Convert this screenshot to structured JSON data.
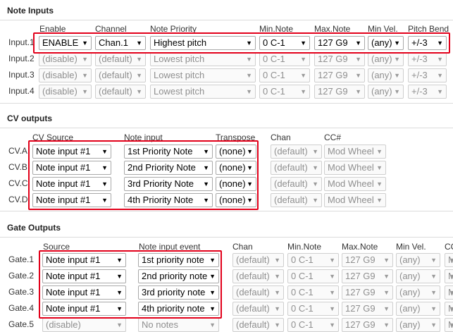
{
  "note_inputs": {
    "title": "Note Inputs",
    "headers": [
      "Enable",
      "Channel",
      "Note Priority",
      "Min.Note",
      "Max.Note",
      "Min Vel.",
      "Pitch Bend"
    ],
    "rows": [
      {
        "label": "Input.1",
        "enabled": true,
        "values": [
          "ENABLE",
          "Chan.1",
          "Highest pitch",
          "0 C-1",
          "127 G9",
          "(any)",
          "+/-3"
        ]
      },
      {
        "label": "Input.2",
        "enabled": false,
        "values": [
          "(disable)",
          "(default)",
          "Lowest pitch",
          "0 C-1",
          "127 G9",
          "(any)",
          "+/-3"
        ]
      },
      {
        "label": "Input.3",
        "enabled": false,
        "values": [
          "(disable)",
          "(default)",
          "Lowest pitch",
          "0 C-1",
          "127 G9",
          "(any)",
          "+/-3"
        ]
      },
      {
        "label": "Input.4",
        "enabled": false,
        "values": [
          "(disable)",
          "(default)",
          "Lowest pitch",
          "0 C-1",
          "127 G9",
          "(any)",
          "+/-3"
        ]
      }
    ]
  },
  "cv_outputs": {
    "title": "CV outputs",
    "headers": [
      "CV Source",
      "Note input",
      "Transpose",
      "Chan",
      "CC#"
    ],
    "rows": [
      {
        "label": "CV.A",
        "values": [
          "Note input #1",
          "1st Priority Note",
          "(none)",
          "(default)",
          "Mod Wheel"
        ]
      },
      {
        "label": "CV.B",
        "values": [
          "Note input #1",
          "2nd Priority Note",
          "(none)",
          "(default)",
          "Mod Wheel"
        ]
      },
      {
        "label": "CV.C",
        "values": [
          "Note input #1",
          "3rd Priority Note",
          "(none)",
          "(default)",
          "Mod Wheel"
        ]
      },
      {
        "label": "CV.D",
        "values": [
          "Note input #1",
          "4th Priority Note",
          "(none)",
          "(default)",
          "Mod Wheel"
        ]
      }
    ]
  },
  "gate_outputs": {
    "title": "Gate Outputs",
    "headers": [
      "Source",
      "Note input event",
      "Chan",
      "Min.Note",
      "Max.Note",
      "Min Vel.",
      "CC"
    ],
    "rows": [
      {
        "label": "Gate.1",
        "values": [
          "Note input #1",
          "1st priority note",
          "(default)",
          "0 C-1",
          "127 G9",
          "(any)",
          "M"
        ]
      },
      {
        "label": "Gate.2",
        "values": [
          "Note input #1",
          "2nd priority note",
          "(default)",
          "0 C-1",
          "127 G9",
          "(any)",
          "M"
        ]
      },
      {
        "label": "Gate.3",
        "values": [
          "Note input #1",
          "3rd priority note",
          "(default)",
          "0 C-1",
          "127 G9",
          "(any)",
          "M"
        ]
      },
      {
        "label": "Gate.4",
        "values": [
          "Note input #1",
          "4th priority note",
          "(default)",
          "0 C-1",
          "127 G9",
          "(any)",
          "M"
        ]
      },
      {
        "label": "Gate.5",
        "values": [
          "(disable)",
          "No notes",
          "(default)",
          "0 C-1",
          "127 G9",
          "(any)",
          "M"
        ]
      }
    ]
  },
  "highlight_color": "#e2001a",
  "icons": {
    "dropdown": "chevron-down-icon"
  }
}
